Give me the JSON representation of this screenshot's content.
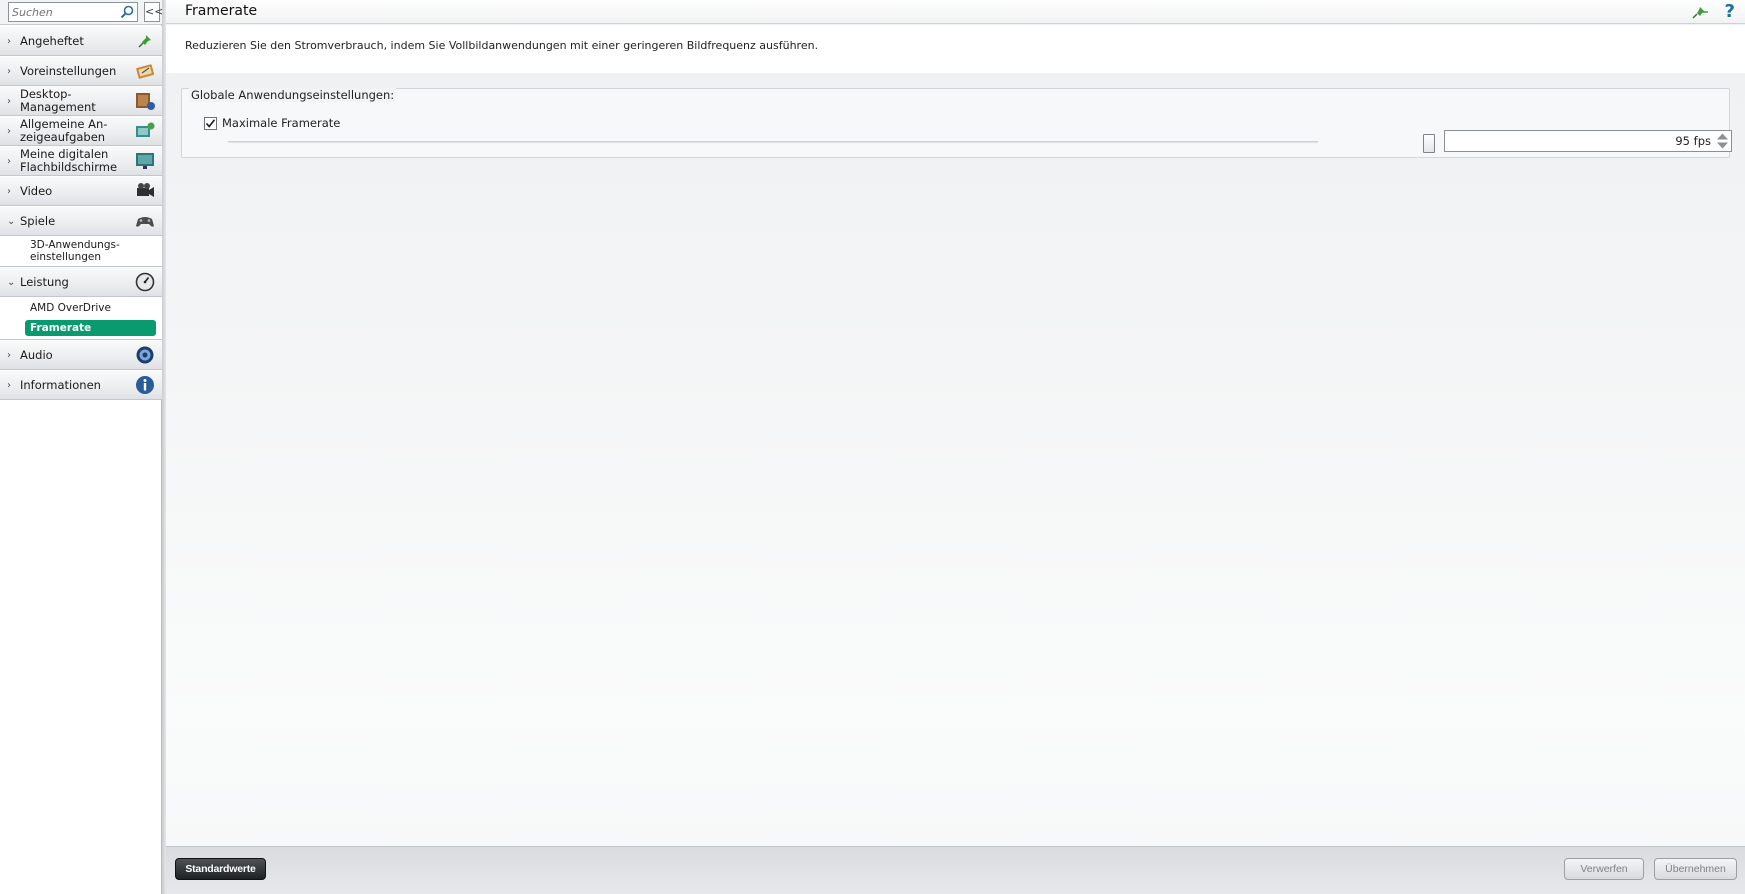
{
  "search": {
    "placeholder": "Suchen"
  },
  "sidebar": {
    "collapse_label": "<<",
    "items": [
      {
        "label": "Angeheftet",
        "icon": "pin-icon",
        "expanded": false
      },
      {
        "label": "Voreinstellungen",
        "icon": "presets-icon",
        "expanded": false
      },
      {
        "label": "Desktop-\nManagement",
        "icon": "desktop-management-icon",
        "expanded": false
      },
      {
        "label": "Allgemeine An-\nzeigeaufgaben",
        "icon": "display-tasks-icon",
        "expanded": false
      },
      {
        "label": "Meine digitalen\nFlachbildschirme",
        "icon": "flat-panel-icon",
        "expanded": false
      },
      {
        "label": "Video",
        "icon": "video-camera-icon",
        "expanded": false
      },
      {
        "label": "Spiele",
        "icon": "gamepad-icon",
        "expanded": true,
        "children": [
          {
            "label": "3D-Anwendungs-\neinstellungen"
          }
        ]
      },
      {
        "label": "Leistung",
        "icon": "gauge-icon",
        "expanded": true,
        "children": [
          {
            "label": "AMD OverDrive"
          },
          {
            "label": "Framerate",
            "active": true
          }
        ]
      },
      {
        "label": "Audio",
        "icon": "audio-icon",
        "expanded": false
      },
      {
        "label": "Informationen",
        "icon": "info-icon",
        "expanded": false
      }
    ]
  },
  "header": {
    "title": "Framerate",
    "help_label": "?"
  },
  "description": "Reduzieren Sie den Stromverbrauch, indem Sie Vollbildanwendungen mit einer geringeren Bildfrequenz ausführen.",
  "group": {
    "title": "Globale Anwendungseinstellungen:",
    "checkbox_label": "Maximale Framerate",
    "checkbox_checked": true,
    "fps_value": "95 fps",
    "slider_fraction": 0.95
  },
  "footer": {
    "defaults_label": "Standardwerte",
    "discard_label": "Verwerfen",
    "apply_label": "Übernehmen"
  },
  "colors": {
    "accent_active": "#0a9a70",
    "help_blue": "#1f6f9a"
  }
}
